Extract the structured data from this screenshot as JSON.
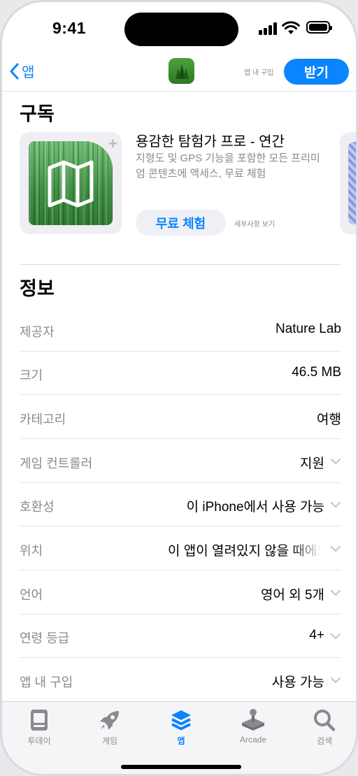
{
  "status_bar": {
    "time": "9:41"
  },
  "nav": {
    "back_label": "앱",
    "iap_note": "앱 내 구입",
    "get_label": "받기"
  },
  "subscription": {
    "section_title": "구독",
    "title": "용감한 탐험가 프로 - 연간",
    "description": "지형도 및 GPS 기능을 포함한 모든 프리미엄 콘텐츠에 액세스, 무료 체험",
    "trial_button": "무료 체험",
    "details_link": "세부사항 보기"
  },
  "info": {
    "section_title": "정보",
    "rows": [
      {
        "label": "제공자",
        "value": "Nature Lab",
        "chevron": false
      },
      {
        "label": "크기",
        "value": "46.5 MB",
        "chevron": false
      },
      {
        "label": "카테고리",
        "value": "여행",
        "chevron": false
      },
      {
        "label": "게임 컨트롤러",
        "value": "지원",
        "chevron": true
      },
      {
        "label": "호환성",
        "value": "이 iPhone에서 사용 가능",
        "chevron": true
      },
      {
        "label": "위치",
        "value": "이 앱이 열려있지 않을 때에도",
        "chevron": true
      },
      {
        "label": "언어",
        "value": "영어 외 5개",
        "chevron": true
      },
      {
        "label": "연령 등급",
        "value": "4+",
        "chevron": true
      },
      {
        "label": "앱 내 구입",
        "value": "사용 가능",
        "chevron": true
      }
    ]
  },
  "tabs": [
    {
      "label": "투데이",
      "icon": "today-icon",
      "active": false
    },
    {
      "label": "게임",
      "icon": "rocket-icon",
      "active": false
    },
    {
      "label": "앱",
      "icon": "apps-stack-icon",
      "active": true
    },
    {
      "label": "Arcade",
      "icon": "joystick-icon",
      "active": false
    },
    {
      "label": "검색",
      "icon": "search-icon",
      "active": false
    }
  ],
  "colors": {
    "accent": "#0a84ff",
    "secondary_text": "#8a8a8e"
  }
}
